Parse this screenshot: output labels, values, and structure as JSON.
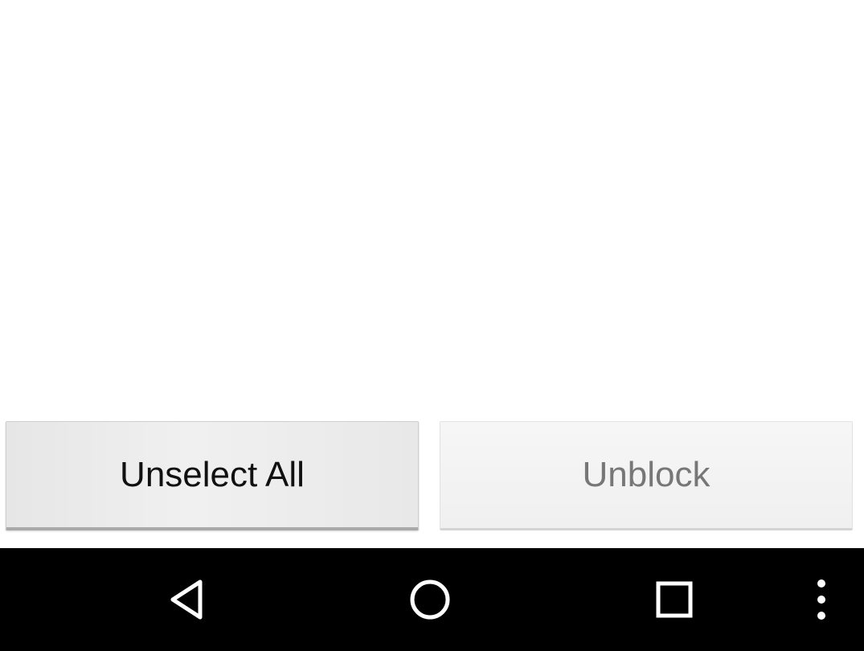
{
  "buttons": {
    "unselect_all": "Unselect All",
    "unblock": "Unblock"
  },
  "nav_bar": {
    "icons": [
      "back-icon",
      "home-icon",
      "recents-icon",
      "overflow-menu-icon"
    ]
  },
  "colors": {
    "nav_background": "#000000",
    "nav_icon": "#ffffff",
    "enabled_text": "#111111",
    "disabled_text": "#777777"
  }
}
